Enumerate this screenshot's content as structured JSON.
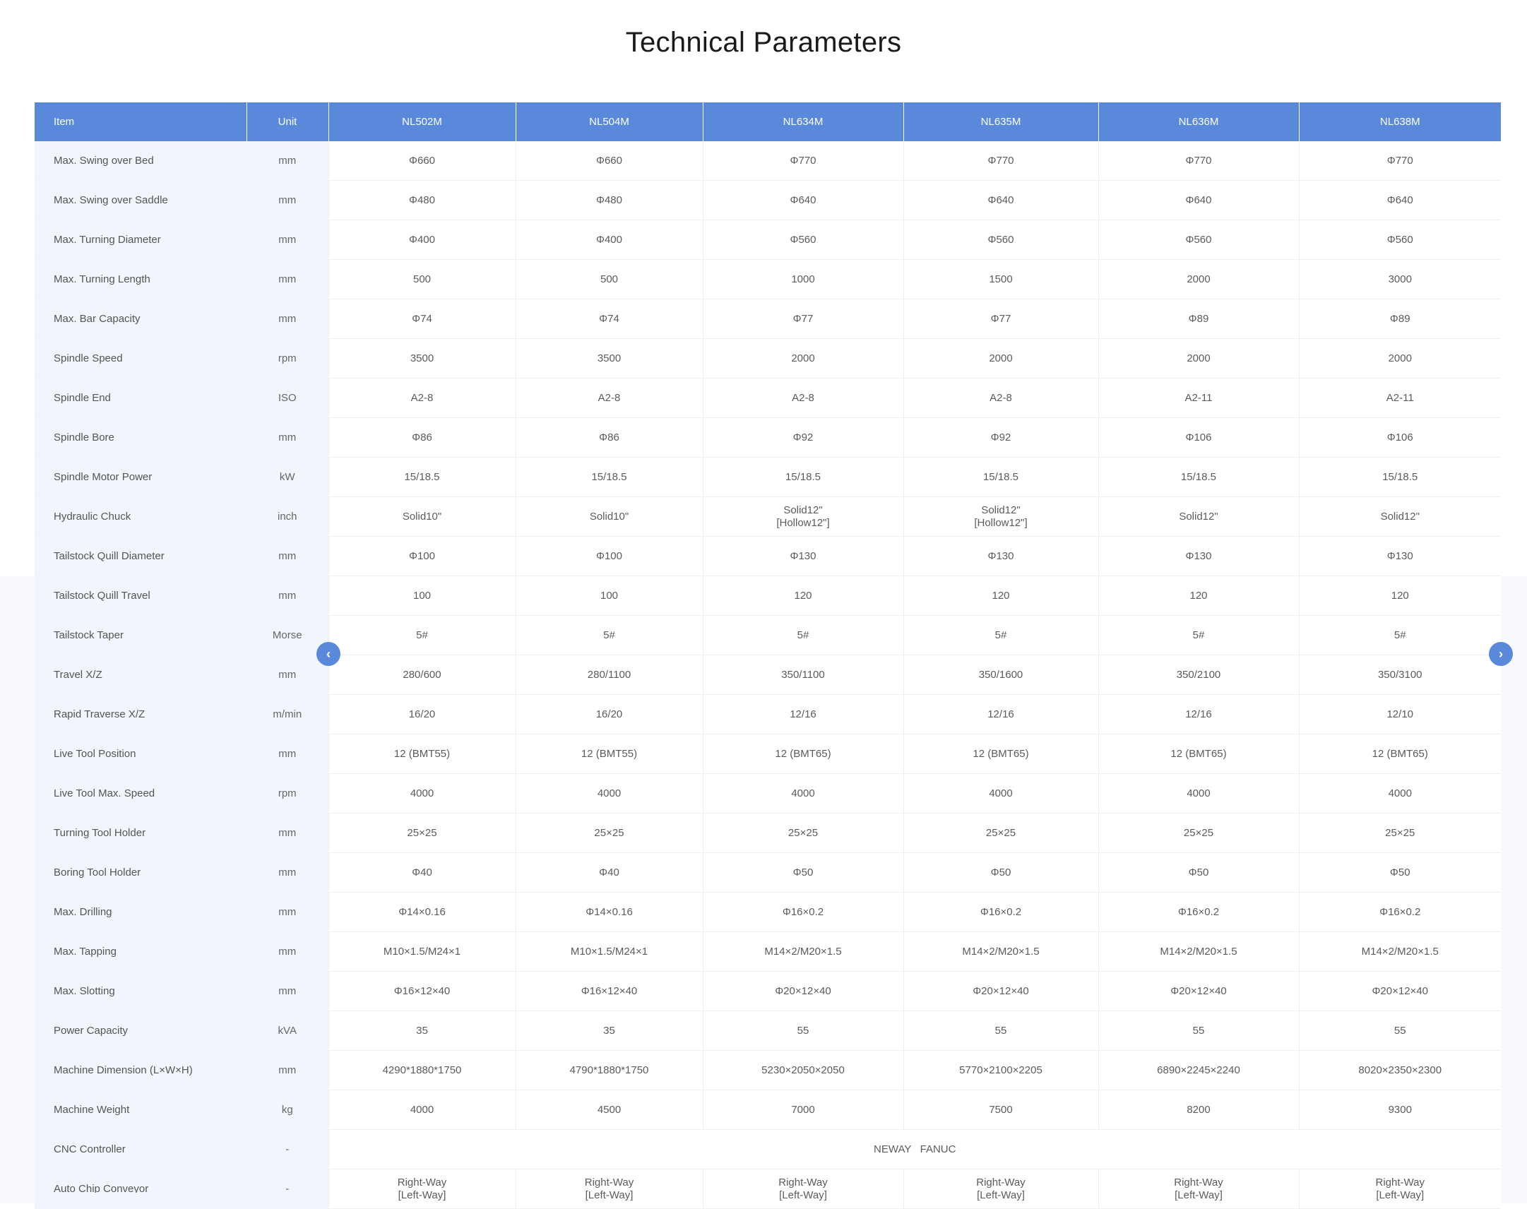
{
  "page": {
    "title": "Technical Parameters"
  },
  "table": {
    "headers": [
      "Item",
      "Unit",
      "NL502M",
      "NL504M",
      "NL634M",
      "NL635M",
      "NL636M",
      "NL638M"
    ],
    "rows": [
      {
        "item": "Max. Swing over Bed",
        "unit": "mm",
        "values": [
          "Φ660",
          "Φ660",
          "Φ770",
          "Φ770",
          "Φ770",
          "Φ770"
        ]
      },
      {
        "item": "Max. Swing over Saddle",
        "unit": "mm",
        "values": [
          "Φ480",
          "Φ480",
          "Φ640",
          "Φ640",
          "Φ640",
          "Φ640"
        ]
      },
      {
        "item": "Max. Turning Diameter",
        "unit": "mm",
        "values": [
          "Φ400",
          "Φ400",
          "Φ560",
          "Φ560",
          "Φ560",
          "Φ560"
        ]
      },
      {
        "item": "Max. Turning Length",
        "unit": "mm",
        "values": [
          "500",
          "500",
          "1000",
          "1500",
          "2000",
          "3000"
        ]
      },
      {
        "item": "Max. Bar Capacity",
        "unit": "mm",
        "values": [
          "Φ74",
          "Φ74",
          "Φ77",
          "Φ77",
          "Φ89",
          "Φ89"
        ]
      },
      {
        "item": "Spindle Speed",
        "unit": "rpm",
        "values": [
          "3500",
          "3500",
          "2000",
          "2000",
          "2000",
          "2000"
        ]
      },
      {
        "item": "Spindle End",
        "unit": "ISO",
        "values": [
          "A2-8",
          "A2-8",
          "A2-8",
          "A2-8",
          "A2-11",
          "A2-11"
        ]
      },
      {
        "item": "Spindle Bore",
        "unit": "mm",
        "values": [
          "Φ86",
          "Φ86",
          "Φ92",
          "Φ92",
          "Φ106",
          "Φ106"
        ]
      },
      {
        "item": "Spindle Motor Power",
        "unit": "kW",
        "values": [
          "15/18.5",
          "15/18.5",
          "15/18.5",
          "15/18.5",
          "15/18.5",
          "15/18.5"
        ]
      },
      {
        "item": "Hydraulic Chuck",
        "unit": "inch",
        "values": [
          "Solid10\"",
          "Solid10\"",
          "Solid12\"\n[Hollow12\"]",
          "Solid12\"\n[Hollow12\"]",
          "Solid12\"",
          "Solid12\""
        ]
      },
      {
        "item": "Tailstock Quill Diameter",
        "unit": "mm",
        "values": [
          "Φ100",
          "Φ100",
          "Φ130",
          "Φ130",
          "Φ130",
          "Φ130"
        ]
      },
      {
        "item": "Tailstock Quill Travel",
        "unit": "mm",
        "values": [
          "100",
          "100",
          "120",
          "120",
          "120",
          "120"
        ]
      },
      {
        "item": "Tailstock Taper",
        "unit": "Morse",
        "values": [
          "5#",
          "5#",
          "5#",
          "5#",
          "5#",
          "5#"
        ]
      },
      {
        "item": "Travel X/Z",
        "unit": "mm",
        "values": [
          "280/600",
          "280/1100",
          "350/1100",
          "350/1600",
          "350/2100",
          "350/3100"
        ]
      },
      {
        "item": "Rapid Traverse X/Z",
        "unit": "m/min",
        "values": [
          "16/20",
          "16/20",
          "12/16",
          "12/16",
          "12/16",
          "12/10"
        ]
      },
      {
        "item": "Live Tool Position",
        "unit": "mm",
        "values": [
          "12   (BMT55)",
          "12   (BMT55)",
          "12   (BMT65)",
          "12   (BMT65)",
          "12   (BMT65)",
          "12   (BMT65)"
        ]
      },
      {
        "item": "Live Tool Max. Speed",
        "unit": "rpm",
        "values": [
          "4000",
          "4000",
          "4000",
          "4000",
          "4000",
          "4000"
        ]
      },
      {
        "item": "Turning Tool Holder",
        "unit": "mm",
        "values": [
          "25×25",
          "25×25",
          "25×25",
          "25×25",
          "25×25",
          "25×25"
        ]
      },
      {
        "item": "Boring Tool Holder",
        "unit": "mm",
        "values": [
          "Φ40",
          "Φ40",
          "Φ50",
          "Φ50",
          "Φ50",
          "Φ50"
        ]
      },
      {
        "item": "Max. Drilling",
        "unit": "mm",
        "values": [
          "Φ14×0.16",
          "Φ14×0.16",
          "Φ16×0.2",
          "Φ16×0.2",
          "Φ16×0.2",
          "Φ16×0.2"
        ]
      },
      {
        "item": "Max. Tapping",
        "unit": "mm",
        "values": [
          "M10×1.5/M24×1",
          "M10×1.5/M24×1",
          "M14×2/M20×1.5",
          "M14×2/M20×1.5",
          "M14×2/M20×1.5",
          "M14×2/M20×1.5"
        ]
      },
      {
        "item": "Max. Slotting",
        "unit": "mm",
        "values": [
          "Φ16×12×40",
          "Φ16×12×40",
          "Φ20×12×40",
          "Φ20×12×40",
          "Φ20×12×40",
          "Φ20×12×40"
        ]
      },
      {
        "item": "Power Capacity",
        "unit": "kVA",
        "values": [
          "35",
          "35",
          "55",
          "55",
          "55",
          "55"
        ]
      },
      {
        "item": "Machine Dimension (L×W×H)",
        "unit": "mm",
        "values": [
          "4290*1880*1750",
          "4790*1880*1750",
          "5230×2050×2050",
          "5770×2100×2205",
          "6890×2245×2240",
          "8020×2350×2300"
        ]
      },
      {
        "item": "Machine Weight",
        "unit": "kg",
        "values": [
          "4000",
          "4500",
          "7000",
          "7500",
          "8200",
          "9300"
        ]
      },
      {
        "item": "CNC Controller",
        "unit": "-",
        "merged": "NEWAY   FANUC"
      },
      {
        "item": "Auto Chip Conveyor",
        "unit": "-",
        "values": [
          "Right-Way\n[Left-Way]",
          "Right-Way\n[Left-Way]",
          "Right-Way\n[Left-Way]",
          "Right-Way\n[Left-Way]",
          "Right-Way\n[Left-Way]",
          "Right-Way\n[Left-Way]"
        ]
      }
    ]
  },
  "nav": {
    "prev_icon": "chevron-left-icon",
    "prev_glyph": "‹",
    "next_icon": "chevron-right-icon",
    "next_glyph": "›"
  },
  "colors": {
    "header_bg": "#5a89dc",
    "label_bg": "#f1f5fc",
    "accent": "#5a89dc"
  }
}
